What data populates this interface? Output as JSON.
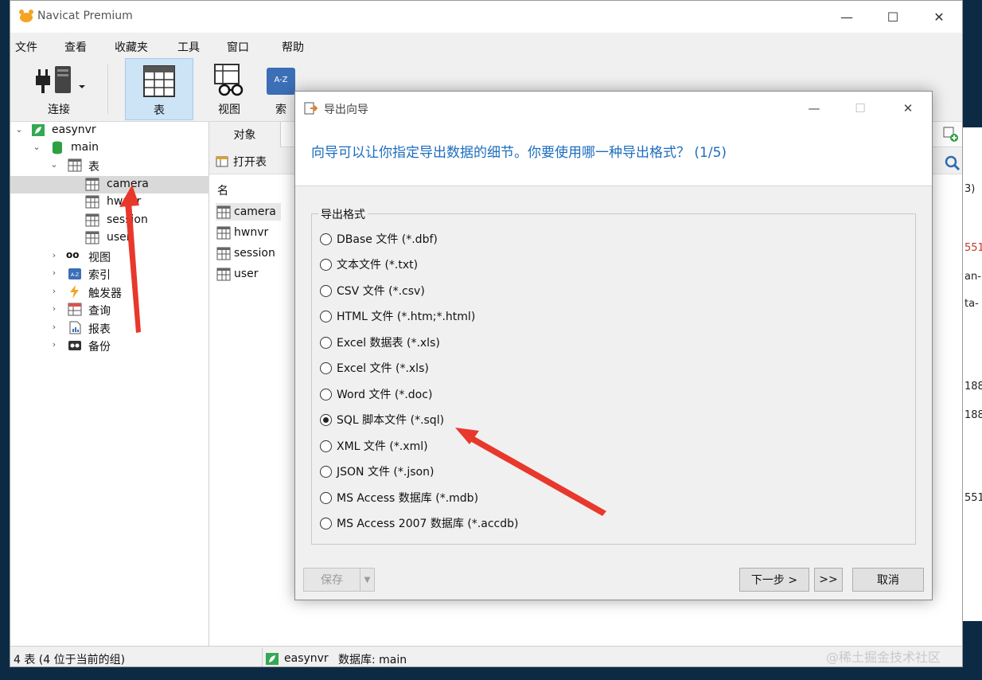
{
  "app": {
    "title": "Navicat Premium",
    "window_controls": {
      "minimize": "—",
      "maximize": "☐",
      "close": "✕"
    }
  },
  "menu": [
    "文件",
    "查看",
    "收藏夹",
    "工具",
    "窗口",
    "帮助"
  ],
  "toolbar": {
    "connect": "连接",
    "table": "表",
    "view": "视图",
    "index_partial": "索"
  },
  "tree": {
    "connection": "easynvr",
    "database": "main",
    "tables_group": "表",
    "tables": [
      "camera",
      "hwnvr",
      "session",
      "user"
    ],
    "groups": [
      "视图",
      "索引",
      "触发器",
      "查询",
      "报表",
      "备份"
    ]
  },
  "objects": {
    "tab": "对象",
    "open_table": "打开表",
    "name_header": "名",
    "rows": [
      "camera",
      "hwnvr",
      "session",
      "user"
    ]
  },
  "peek_texts": [
    "3)",
    "551",
    "an-",
    "ta-",
    "188",
    "188",
    "551"
  ],
  "status": {
    "left": "4 表 (4 位于当前的组)",
    "connection": "easynvr",
    "database": "数据库: main",
    "watermark": "@稀土掘金技术社区"
  },
  "dialog": {
    "title": "导出向导",
    "controls": {
      "minimize": "—",
      "maximize": "☐",
      "close": "✕"
    },
    "heading": "向导可以让你指定导出数据的细节。你要使用哪一种导出格式？ (1/5)",
    "group_label": "导出格式",
    "formats": [
      "DBase 文件 (*.dbf)",
      "文本文件 (*.txt)",
      "CSV 文件 (*.csv)",
      "HTML 文件 (*.htm;*.html)",
      "Excel 数据表 (*.xls)",
      "Excel 文件 (*.xls)",
      "Word 文件 (*.doc)",
      "SQL 脚本文件 (*.sql)",
      "XML 文件 (*.xml)",
      "JSON 文件 (*.json)",
      "MS Access 数据库 (*.mdb)",
      "MS Access 2007 数据库 (*.accdb)"
    ],
    "selected_format": "SQL 脚本文件 (*.sql)",
    "buttons": {
      "save": "保存",
      "next": "下一步 >",
      "skip": ">>",
      "cancel": "取消"
    }
  },
  "colors": {
    "accent": "#1d6dbd",
    "annotation_arrow": "#e8382c",
    "toolbar_active": "#cde3f6"
  }
}
